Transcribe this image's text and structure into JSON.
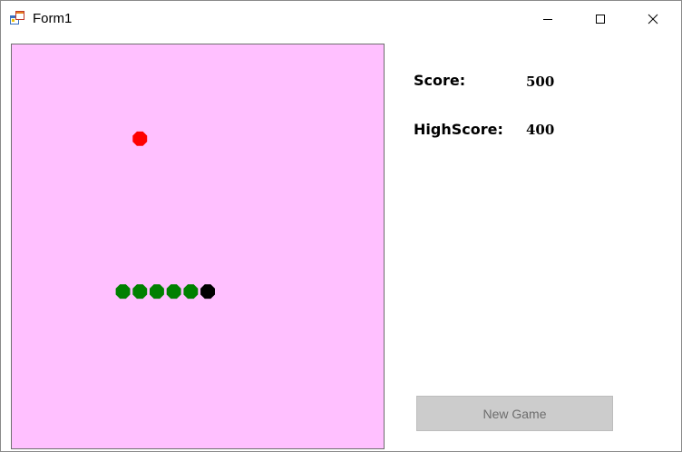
{
  "window": {
    "title": "Form1",
    "minimize_icon": "minimize-icon",
    "maximize_icon": "maximize-icon",
    "close_icon": "close-icon",
    "app_icon": "winforms-app-icon"
  },
  "game": {
    "board_color": "#ffc0ff",
    "food": {
      "col": 7,
      "row": 5,
      "color": "#ff0000"
    },
    "snake": {
      "head_color": "#000000",
      "body_color": "#008000",
      "segments": [
        {
          "col": 11,
          "row": 14
        },
        {
          "col": 10,
          "row": 14
        },
        {
          "col": 9,
          "row": 14
        },
        {
          "col": 8,
          "row": 14
        },
        {
          "col": 7,
          "row": 14
        },
        {
          "col": 6,
          "row": 14
        }
      ]
    }
  },
  "scoreboard": {
    "score_label": "Score:",
    "score_value": "500",
    "highscore_label": "HighScore:",
    "highscore_value": "400"
  },
  "controls": {
    "new_game_label": "New Game"
  }
}
